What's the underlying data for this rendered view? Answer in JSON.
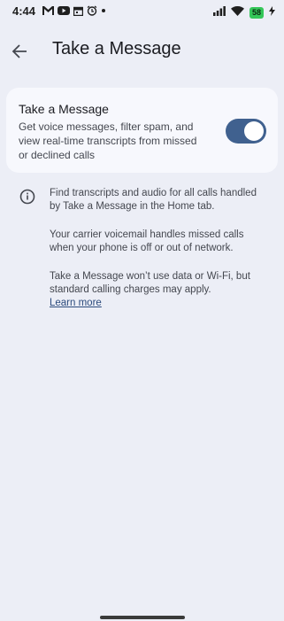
{
  "status_bar": {
    "time": "4:44",
    "battery": "58",
    "icons": [
      "gmail-icon",
      "youtube-icon",
      "calendar-icon",
      "alarm-icon",
      "dot-icon",
      "signal-icon",
      "wifi-icon",
      "battery-icon",
      "charging-icon"
    ]
  },
  "app_bar": {
    "title": "Take a Message",
    "back_icon": "arrow-left-icon"
  },
  "card": {
    "title": "Take a Message",
    "description": "Get voice messages, filter spam, and view real-time transcripts from missed or declined calls",
    "toggle_on": true
  },
  "info": {
    "icon": "info-icon",
    "paragraph1": "Find transcripts and audio for all calls handled by Take a Message in the Home tab.",
    "paragraph2": "Your carrier voicemail handles missed calls when your phone is off or out of network.",
    "paragraph3": "Take a Message won’t use data or Wi-Fi, but standard calling charges may apply.",
    "learn_more": "Learn more"
  },
  "colors": {
    "background": "#eceef6",
    "card": "#f7f8fd",
    "toggle_track": "#40618f",
    "link": "#2c4b7d"
  }
}
